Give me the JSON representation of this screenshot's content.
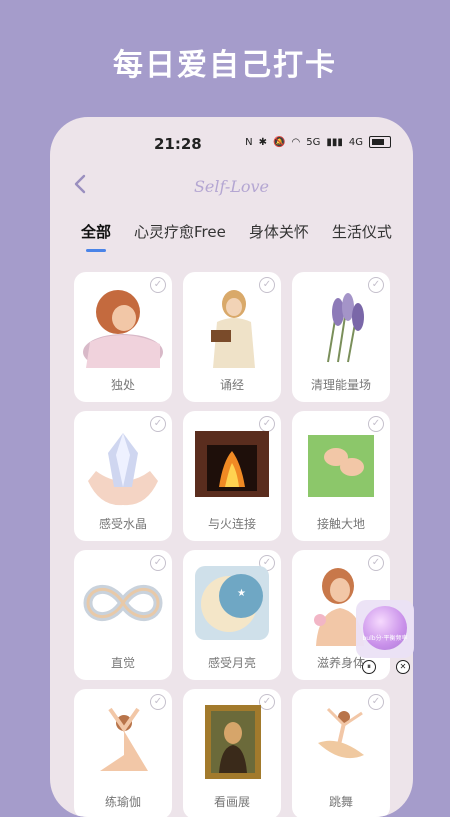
{
  "banner": {
    "title": "每日爱自己打卡"
  },
  "status_bar": {
    "time": "21:28",
    "net1": "5G",
    "net2": "4G"
  },
  "header": {
    "title": "Self-Love"
  },
  "tabs": [
    {
      "label": "全部"
    },
    {
      "label": "心灵疗愈Free"
    },
    {
      "label": "身体关怀"
    },
    {
      "label": "生活仪式"
    }
  ],
  "cards": [
    {
      "label": "独处",
      "icon": "resting-woman-illustration"
    },
    {
      "label": "诵经",
      "icon": "reading-woman-illustration"
    },
    {
      "label": "清理能量场",
      "icon": "lavender-illustration"
    },
    {
      "label": "感受水晶",
      "icon": "crystal-in-hands-illustration"
    },
    {
      "label": "与火连接",
      "icon": "fireplace-illustration"
    },
    {
      "label": "接触大地",
      "icon": "feet-on-grass-illustration"
    },
    {
      "label": "直觉",
      "icon": "infinity-illustration"
    },
    {
      "label": "感受月亮",
      "icon": "moon-illustration"
    },
    {
      "label": "滋养身体",
      "icon": "woman-with-flower-illustration"
    },
    {
      "label": "练瑜伽",
      "icon": "yoga-woman-illustration"
    },
    {
      "label": "看画展",
      "icon": "mona-lisa-illustration"
    },
    {
      "label": "跳舞",
      "icon": "dancer-illustration"
    }
  ],
  "float_widget": {
    "text": "bulb分·平衡频率"
  },
  "colors": {
    "background": "#a59ccb",
    "panel": "#ede4ea",
    "accent": "#4a84e8"
  }
}
